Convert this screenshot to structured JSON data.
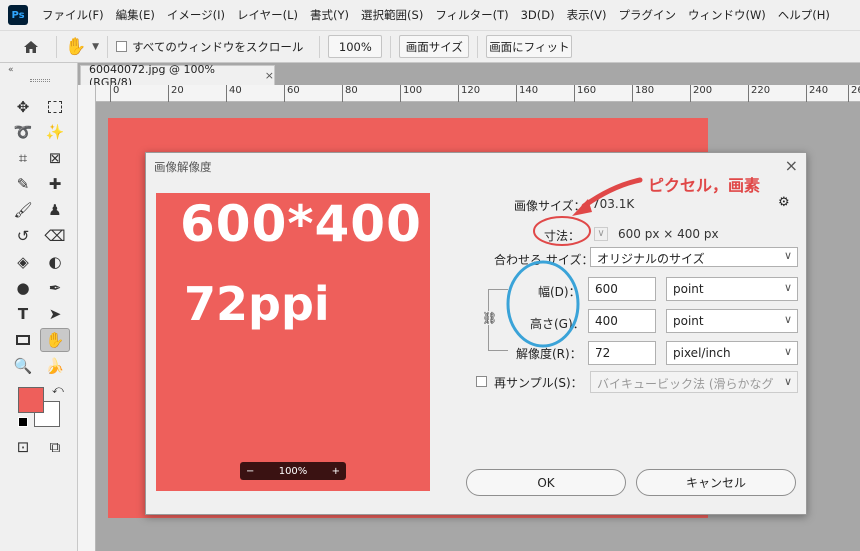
{
  "menubar": {
    "logo": "Ps",
    "items": [
      "ファイル(F)",
      "編集(E)",
      "イメージ(I)",
      "レイヤー(L)",
      "書式(Y)",
      "選択範囲(S)",
      "フィルター(T)",
      "3D(D)",
      "表示(V)",
      "プラグイン",
      "ウィンドウ(W)",
      "ヘルプ(H)"
    ]
  },
  "options": {
    "scroll_all_label": "すべてのウィンドウをスクロール",
    "zoom_value": "100%",
    "fit_screen": "画面サイズ",
    "fill_screen": "画面にフィット"
  },
  "document": {
    "tab_title": "60040072.jpg @ 100% (RGB/8)",
    "tab_close": "×",
    "ruler_labels": [
      "0",
      "20",
      "40",
      "60",
      "80",
      "100",
      "120",
      "140",
      "160",
      "180",
      "200",
      "220",
      "240",
      "26"
    ],
    "canvas_color": "#ee5f5b"
  },
  "dialog": {
    "title": "画像解像度",
    "close": "×",
    "preview_main": "600*400",
    "preview_sub": "72ppi",
    "zoom_minus": "−",
    "zoom_value": "100%",
    "zoom_plus": "+",
    "image_size_label": "画像サイズ：",
    "image_size_value": "703.1K",
    "dimensions_label": "寸法：",
    "dimensions_value": "600 px × 400 px",
    "fit_label": "合わせる サイズ：",
    "fit_value": "オリジナルのサイズ",
    "width_label": "幅(D)：",
    "width_value": "600",
    "width_unit": "point",
    "height_label": "高さ(G)：",
    "height_value": "400",
    "height_unit": "point",
    "resolution_label": "解像度(R)：",
    "resolution_value": "72",
    "resolution_unit": "pixel/inch",
    "resample_label": "再サンプル(S)：",
    "resample_value": "バイキュービック法 (滑らかなグラ…",
    "ok": "OK",
    "cancel": "キャンセル"
  },
  "annotation": {
    "text": "ピクセル，画素",
    "color": "#e04848",
    "circle_color": "#3aa3d8"
  }
}
